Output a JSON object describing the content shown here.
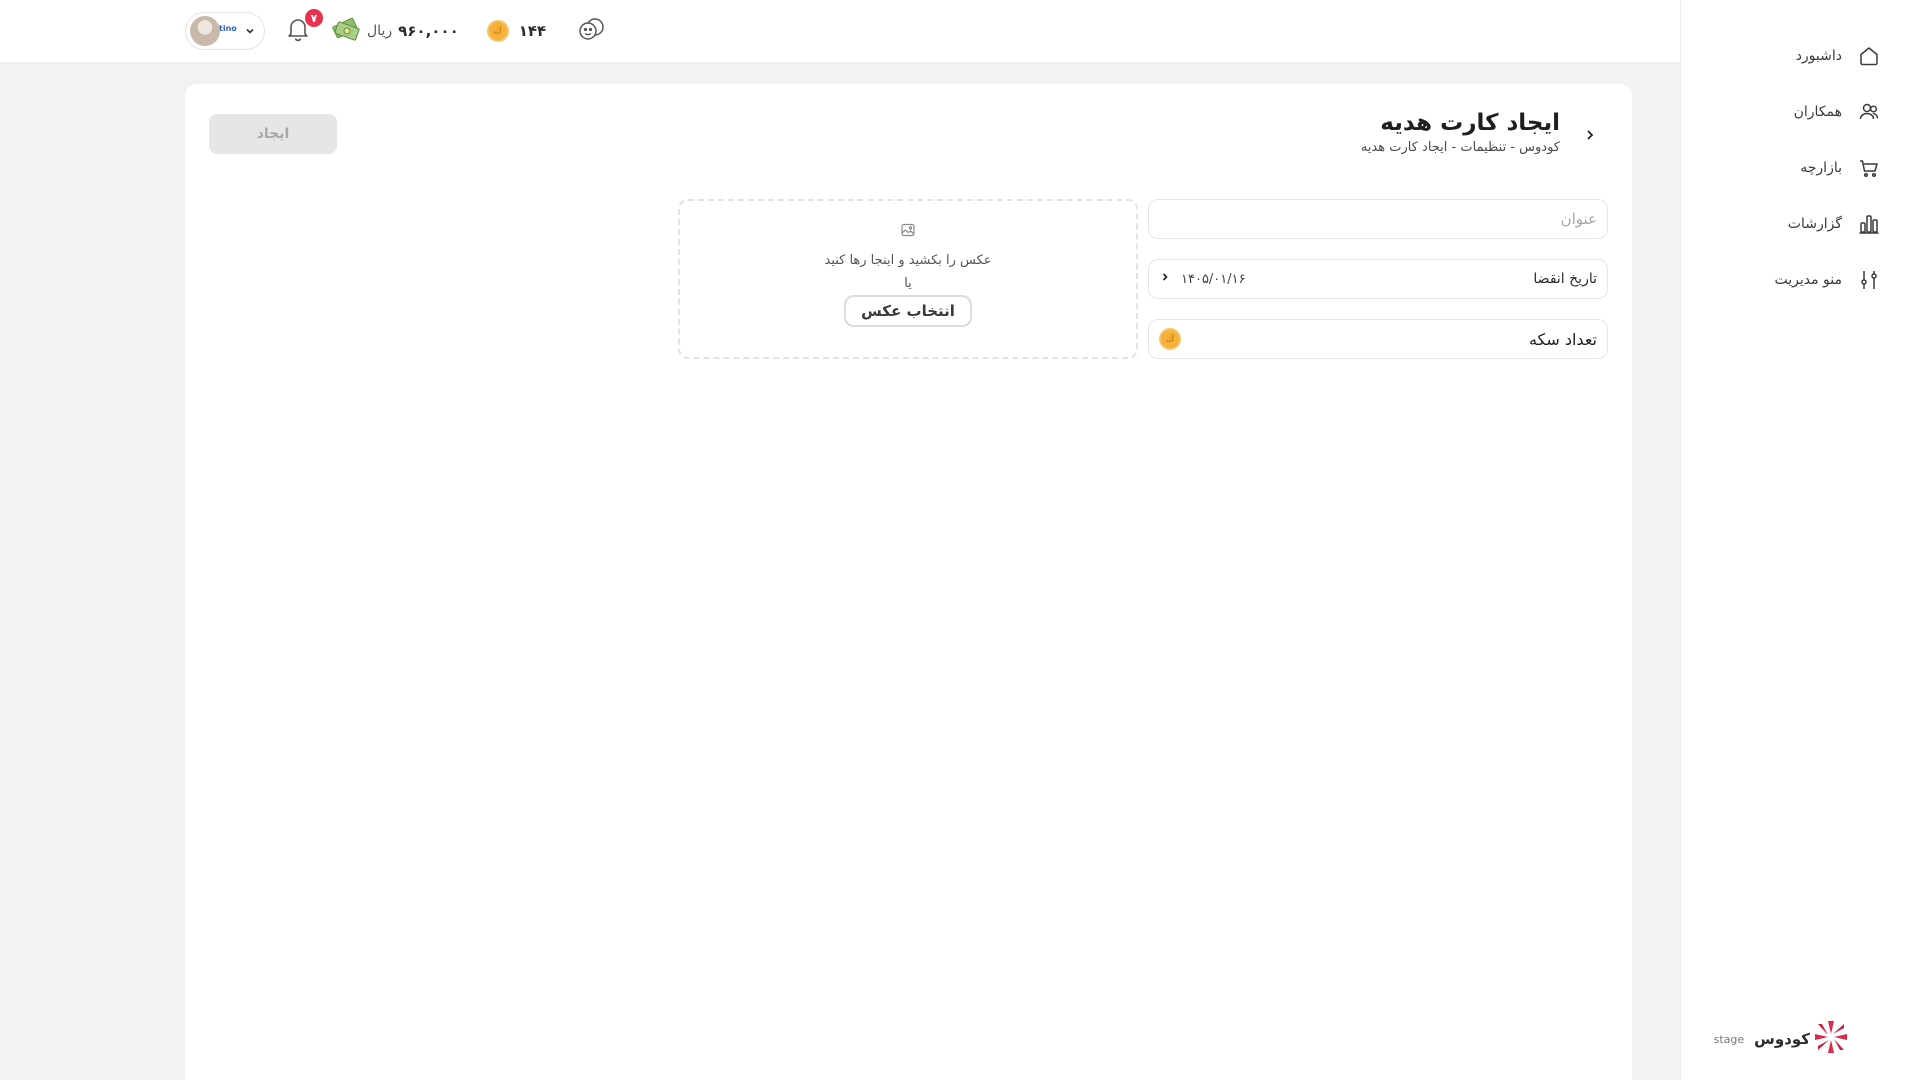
{
  "sidebar": {
    "items": [
      {
        "label": "داشبورد",
        "icon": "home-icon"
      },
      {
        "label": "همکاران",
        "icon": "users-icon"
      },
      {
        "label": "بازارچه",
        "icon": "cart-icon"
      },
      {
        "label": "گزارشات",
        "icon": "bar-chart-icon"
      },
      {
        "label": "منو مدیریت",
        "icon": "sliders-icon"
      }
    ],
    "logo_text": "کودوس",
    "logo_tag": "stage"
  },
  "topbar": {
    "user_name": "tino",
    "notification_count": "۷",
    "wallet_amount": "۹۶۰,۰۰۰",
    "wallet_unit": "ریال",
    "coin_count": "۱۴۴"
  },
  "page": {
    "title": "ایجاد کارت هدیه",
    "breadcrumb": "کودوس - تنظیمات - ایجاد کارت هدیه",
    "create_label": "ایجاد"
  },
  "form": {
    "title_placeholder": "عنوان",
    "expiry_label": "تاریخ انقضا",
    "expiry_value": "۱۴۰۵/۰۱/۱۶",
    "coins_label": "تعداد سکه"
  },
  "upload": {
    "hint": "عکس را بکشید و اینجا رها کنید",
    "or": "یا",
    "button_label": "انتخاب عکس"
  },
  "colors": {
    "accent_red": "#e8304f",
    "coin_gold": "#f5b13d",
    "disabled_bg": "#e6e6e6"
  }
}
